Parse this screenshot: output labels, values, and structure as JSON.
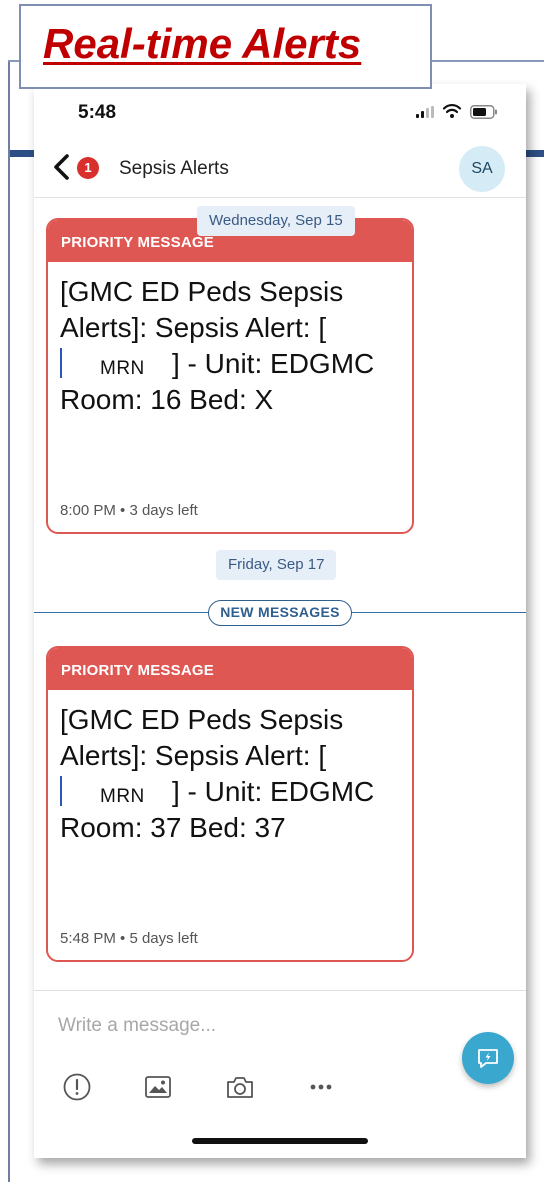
{
  "slide": {
    "title": "Real-time Alerts"
  },
  "status_bar": {
    "time": "5:48"
  },
  "nav": {
    "back_badge_count": "1",
    "title": "Sepsis Alerts",
    "avatar_initials": "SA"
  },
  "conversation": {
    "date_separators": [
      "Wednesday, Sep 15",
      "Friday, Sep 17"
    ],
    "new_messages_label": "NEW MESSAGES",
    "messages": [
      {
        "header": "PRIORITY MESSAGE",
        "text_before_mrn": "[GMC ED Peds Sepsis Alerts]: Sepsis Alert: [",
        "mrn_placeholder": "MRN",
        "text_after_mrn": "] - Unit: EDGMC  Room: 16  Bed: X",
        "meta": "8:00 PM • 3 days left"
      },
      {
        "header": "PRIORITY MESSAGE",
        "text_before_mrn": "[GMC ED Peds Sepsis Alerts]: Sepsis Alert: [",
        "mrn_placeholder": "MRN",
        "text_after_mrn": "] - Unit: EDGMC  Room: 37  Bed: 37",
        "meta": "5:48 PM • 5 days left"
      }
    ]
  },
  "composer": {
    "placeholder": "Write a message...",
    "toolbar_icons": [
      "priority-icon",
      "image-icon",
      "camera-icon",
      "more-icon"
    ],
    "send_icon": "quick-reply-icon"
  },
  "colors": {
    "title_red": "#c00000",
    "priority_red": "#df5752",
    "accent_blue": "#3aa7cf",
    "badge_red": "#d9302e",
    "frame_navy": "#2e4f86"
  }
}
